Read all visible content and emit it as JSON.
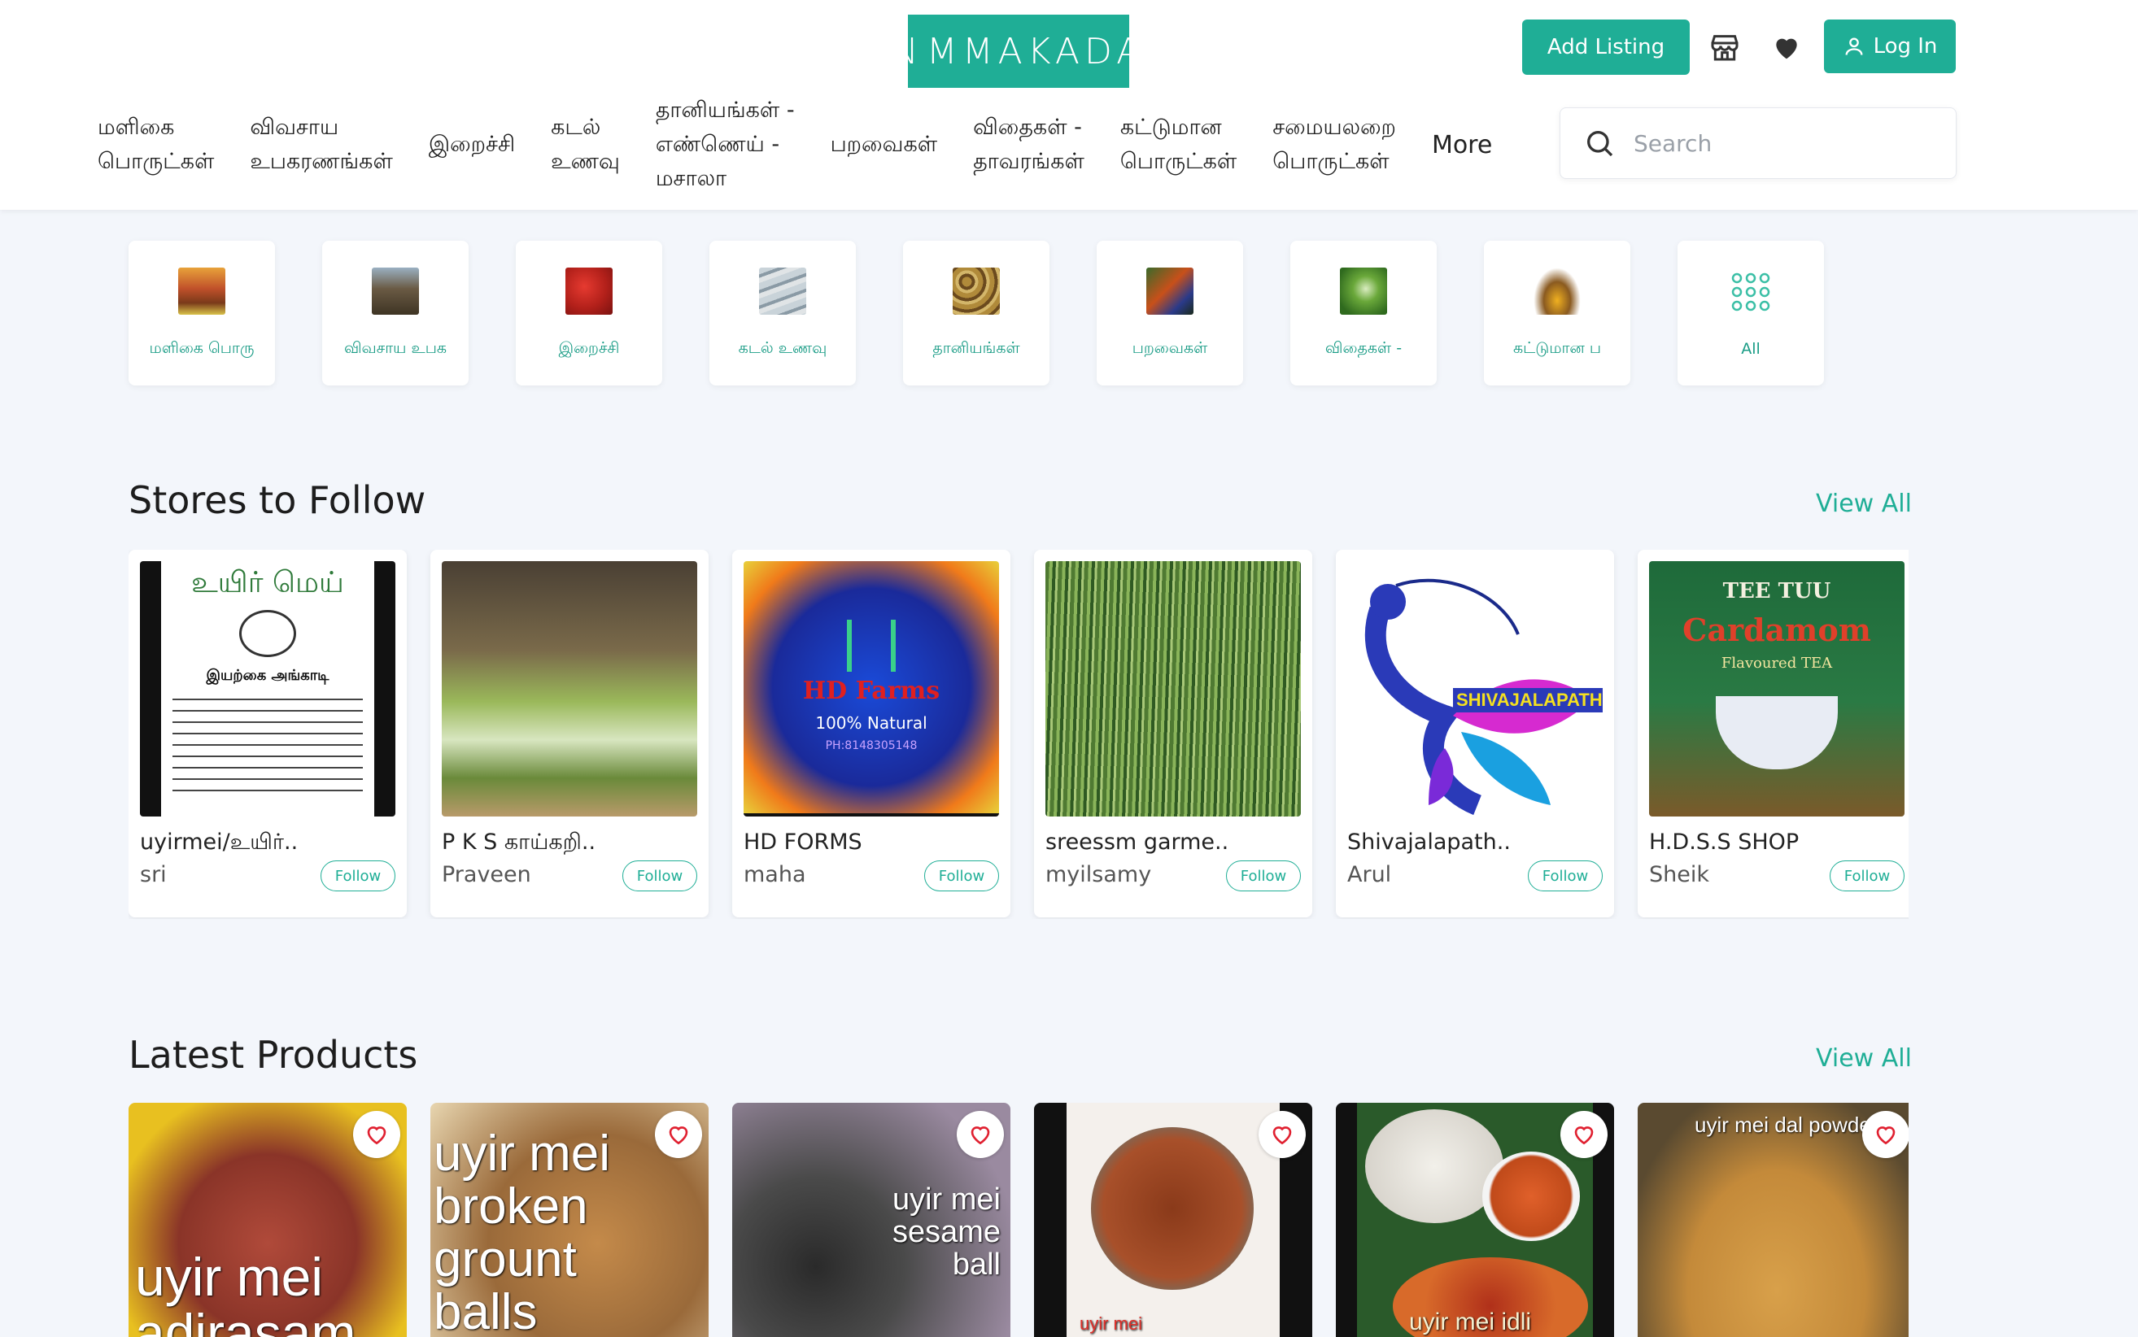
{
  "header": {
    "logo_text": "NAMMAKADA",
    "add_listing_label": "Add Listing",
    "login_label": "Log In",
    "search_placeholder": "Search",
    "nav": [
      "மளிகை\nபொருட்கள்",
      "விவசாய\nஉபகரணங்கள்",
      "இறைச்சி",
      "கடல்\nஉணவு",
      "தானியங்கள் -\nஎண்ணெய் -\nமசாலா",
      "பறவைகள்",
      "விதைகள் -\nதாவரங்கள்",
      "கட்டுமான\nபொருட்கள்",
      "சமையலறை\nபொருட்கள்"
    ],
    "nav_more": "More"
  },
  "categories": [
    {
      "label": "மளிகை பொரு",
      "icon": "groceries-image"
    },
    {
      "label": "விவசாய உபக",
      "icon": "farm-equipment-image"
    },
    {
      "label": "இறைச்சி",
      "icon": "meat-image"
    },
    {
      "label": "கடல் உணவு",
      "icon": "seafood-image"
    },
    {
      "label": "தானியங்கள்",
      "icon": "grains-image"
    },
    {
      "label": "பறவைகள்",
      "icon": "birds-image"
    },
    {
      "label": "விதைகள் -",
      "icon": "seeds-image"
    },
    {
      "label": "கட்டுமான ப",
      "icon": "construction-image"
    },
    {
      "label": "All",
      "icon": "grid-icon"
    }
  ],
  "stores_section": {
    "title": "Stores to Follow",
    "view_all": "View All",
    "follow_label": "Follow",
    "stores": [
      {
        "name": "uyirmei/உயிர்..",
        "owner": "sri",
        "img_title": "உயிர் மெய்",
        "img_sub": "இயற்கை அங்காடி"
      },
      {
        "name": "P K S காய்கறி..",
        "owner": "Praveen"
      },
      {
        "name": "HD FORMS",
        "owner": "maha",
        "img_title": "HD Farms",
        "img_sub": "100% Natural",
        "img_phone": "PH:8148305148"
      },
      {
        "name": "sreessm garme..",
        "owner": "myilsamy"
      },
      {
        "name": "Shivajalapath..",
        "owner": "Arul",
        "img_title": "SHIVAJALAPATHY"
      },
      {
        "name": "H.D.S.S SHOP",
        "owner": "Sheik",
        "img_title": "TEE TUU",
        "img_sub": "Cardamom",
        "img_tag": "Flavoured TEA"
      }
    ]
  },
  "products_section": {
    "title": "Latest Products",
    "view_all": "View All",
    "products": [
      {
        "caption": "uyir mei\nadirasam"
      },
      {
        "caption": "uyir mei\nbroken\ngrount\nballs"
      },
      {
        "caption": "uyir mei\nsesame\nball"
      },
      {
        "caption": "uyir mei"
      },
      {
        "caption": "uyir mei idli"
      },
      {
        "caption": "uyir mei dal powder"
      }
    ]
  },
  "colors": {
    "accent": "#1fae96",
    "background": "#f3f6fb"
  }
}
